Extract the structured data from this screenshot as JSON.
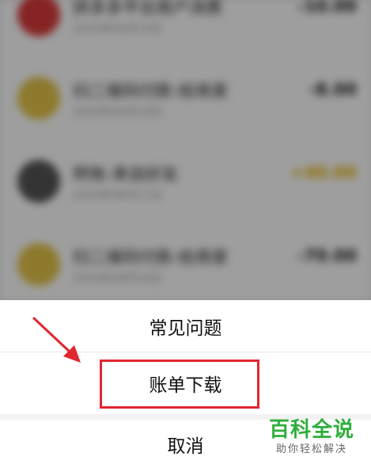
{
  "background_list": [
    {
      "title": "拼多多平台商户消费",
      "subtitle": "2020年06月19日",
      "amount": "-10.00",
      "avatar_color": "#d93a3a",
      "type": "expense"
    },
    {
      "title": "扫二维码付款-给商家",
      "subtitle": "2020年06月18日",
      "amount": "-8.00",
      "avatar_color": "#e4c54a",
      "type": "expense"
    },
    {
      "title": "转账-来自好友",
      "subtitle": "2020年06月17日",
      "amount": "+40.00",
      "avatar_color": "#555555",
      "type": "income"
    },
    {
      "title": "扫二维码付款-给商家",
      "subtitle": "2020年06月16日",
      "amount": "-70.00",
      "avatar_color": "#e4c54a",
      "type": "expense"
    }
  ],
  "action_sheet": {
    "faq_label": "常见问题",
    "bill_download_label": "账单下载",
    "cancel_label": "取消"
  },
  "watermark": {
    "title": "百科全说",
    "subtitle": "助你轻松解决"
  },
  "colors": {
    "highlight": "#e0262f",
    "income": "#e7b200",
    "watermark_green": "#2fae3c"
  }
}
